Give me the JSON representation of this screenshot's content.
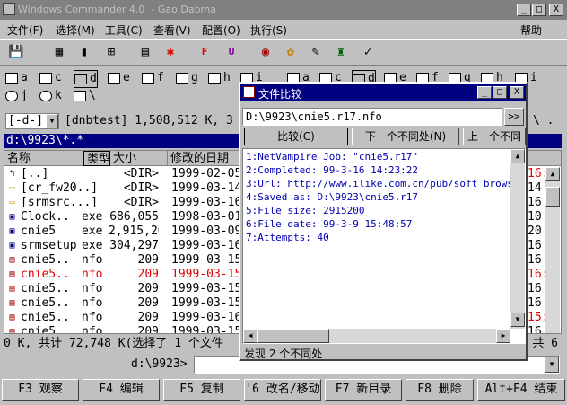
{
  "window": {
    "title": "Windows Commander 4.0  - Gao Dabma",
    "controls": [
      "_",
      "□",
      "X"
    ]
  },
  "menu": [
    "文件(F)",
    "选择(M)",
    "工具(C)",
    "查看(V)",
    "配置(O)",
    "执行(S)",
    "帮助"
  ],
  "toolbar_icons": [
    "floppy-icon",
    "grid-icon",
    "plug-icon",
    "tree-icon",
    "copy-names-icon",
    "star-icon",
    "ftp-icon",
    "url-icon",
    "pack-icon",
    "palette-icon",
    "notepad-icon",
    "lock-icon",
    "check-icon"
  ],
  "toolbar_glyphs": [
    "💾",
    "▦",
    "▮",
    "⊞",
    "▤",
    "✱",
    "F",
    "U",
    "◉",
    "✿",
    "✎",
    "♜",
    "✓"
  ],
  "drives_left": [
    "a",
    "c",
    "d",
    "e",
    "f",
    "g",
    "h",
    "i",
    "j",
    "k",
    "\\"
  ],
  "drives_right": [
    "a",
    "c",
    "d",
    "e",
    "f",
    "g",
    "h",
    "i"
  ],
  "panel": {
    "drive_combo": "[-d-]",
    "volume_info": "[dnbtest]  1,508,512 K, 3",
    "path": "d:\\9923\\*.*",
    "columns": [
      "名称",
      "类型",
      "大小",
      "修改的日期"
    ],
    "files": [
      {
        "name": "[..]",
        "ext": "",
        "size": "<DIR>",
        "date": "1999-02-05",
        "icon": "up",
        "red": false
      },
      {
        "name": "[cr_fw20..]",
        "ext": "",
        "size": "<DIR>",
        "date": "1999-03-14",
        "icon": "folder",
        "red": false
      },
      {
        "name": "[srmsrc...]",
        "ext": "",
        "size": "<DIR>",
        "date": "1999-03-16",
        "icon": "folder",
        "red": false
      },
      {
        "name": "Clock..",
        "ext": "exe",
        "size": "686,055",
        "date": "1998-03-01",
        "icon": "exe",
        "red": false
      },
      {
        "name": "cnie5",
        "ext": "exe",
        "size": "2,915,200",
        "date": "1999-03-09",
        "icon": "exe",
        "red": false
      },
      {
        "name": "srmsetup",
        "ext": "exe",
        "size": "304,297",
        "date": "1999-03-16",
        "icon": "exe",
        "red": false
      },
      {
        "name": "cnie5..",
        "ext": "nfo",
        "size": "209",
        "date": "1999-03-15",
        "icon": "nfo",
        "red": false
      },
      {
        "name": "cnie5..",
        "ext": "nfo",
        "size": "209",
        "date": "1999-03-15",
        "icon": "nfo",
        "red": true
      },
      {
        "name": "cnie5..",
        "ext": "nfo",
        "size": "209",
        "date": "1999-03-15",
        "icon": "nfo",
        "red": false
      },
      {
        "name": "cnie5..",
        "ext": "nfo",
        "size": "209",
        "date": "1999-03-15",
        "icon": "nfo",
        "red": false
      },
      {
        "name": "cnie5..",
        "ext": "nfo",
        "size": "209",
        "date": "1999-03-16",
        "icon": "nfo",
        "red": false
      },
      {
        "name": "cnie5..",
        "ext": "nfo",
        "size": "209",
        "date": "1999-03-15",
        "icon": "nfo",
        "red": false
      }
    ],
    "right_fragments": [
      "16:",
      "14",
      "16",
      "10",
      "20",
      "16",
      "16",
      "16:",
      "16",
      "16",
      "15:",
      "16"
    ],
    "right_fragment_red": [
      true,
      false,
      false,
      false,
      false,
      false,
      false,
      true,
      false,
      false,
      true,
      false
    ],
    "status": "0 K, 共计 72,748 K(选择了 1 个文件",
    "status_right": "共 6",
    "cmd_prompt": "d:\\9923>"
  },
  "fkeys": [
    "F3 观察",
    "F4 编辑",
    "F5 复制",
    "'6 改名/移动",
    "F7 新目录",
    "F8 删除",
    "Alt+F4 结束"
  ],
  "dialog": {
    "title": "文件比较",
    "path": "D:\\9923\\cnie5.r17.nfo",
    "browse": ">>",
    "compare_btn": "比较(C)",
    "next_btn": "下一个不同处(N)",
    "prev_btn": "上一个不同",
    "lines": [
      "1:NetVampire Job: \"cnie5.r17\"",
      "2:Completed: 99-3-16 14:23:22",
      "3:Url: http://www.ilike.com.cn/pub/soft_brows",
      "4:Saved as: D:\\9923\\cnie5.r17",
      "5:File size: 2915200",
      "6:File date: 99-3-9 15:48:57",
      "7:Attempts: 40"
    ],
    "status": "发现 2 个不同处"
  }
}
